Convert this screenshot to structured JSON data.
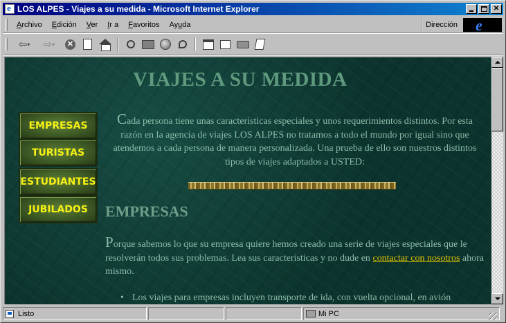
{
  "window": {
    "title": "LOS ALPES - Viajes a su medida - Microsoft Internet Explorer"
  },
  "menu": {
    "items": [
      {
        "pre": "",
        "key": "A",
        "post": "rchivo"
      },
      {
        "pre": "",
        "key": "E",
        "post": "dición"
      },
      {
        "pre": "",
        "key": "V",
        "post": "er"
      },
      {
        "pre": "",
        "key": "I",
        "post": "r a"
      },
      {
        "pre": "",
        "key": "F",
        "post": "avoritos"
      },
      {
        "pre": "Ay",
        "key": "u",
        "post": "da"
      }
    ],
    "address_label": "Dirección"
  },
  "toolbar": {
    "back_glyph": "⇦",
    "forward_glyph": "⇨",
    "icons": [
      "back-icon",
      "forward-icon",
      "stop-icon",
      "refresh-icon",
      "home-icon",
      "search-icon",
      "favorites-icon",
      "history-icon",
      "channels-icon",
      "fullscreen-icon",
      "mail-icon",
      "print-icon",
      "edit-icon"
    ]
  },
  "page": {
    "title": "VIAJES A SU MEDIDA",
    "nav": [
      "EMPRESAS",
      "TURISTAS",
      "ESTUDIANTES",
      "JUBILADOS"
    ],
    "intro_initial": "C",
    "intro_text": "ada persona tiene unas características especiales y unos requerimientos distintos. Por esta razón en la agencia de viajes LOS ALPES no tratamos a todo el mundo por igual sino que atendemos a cada persona de manera personalizada. Una prueba de ello son nuestros distintos tipos de viajes adaptados a USTED:",
    "section_title": "EMPRESAS",
    "section_initial": "P",
    "section_text": "orque sabemos lo que su empresa quiere hemos creado una serie de viajes especiales que le resolverán todos sus problemas. Lea sus características y no dude en ",
    "section_link": "contactar con nosotros",
    "section_text_after": " ahora mismo.",
    "bullet": "Los viajes para empresas incluyen transporte de ida, con vuelta opcional, en avión"
  },
  "status": {
    "text": "Listo",
    "zone": "Mi PC"
  },
  "colors": {
    "title_bar": "#000080",
    "page_bg": "#0e3b35",
    "nav_text": "#f7f214",
    "link": "#e0c000"
  }
}
